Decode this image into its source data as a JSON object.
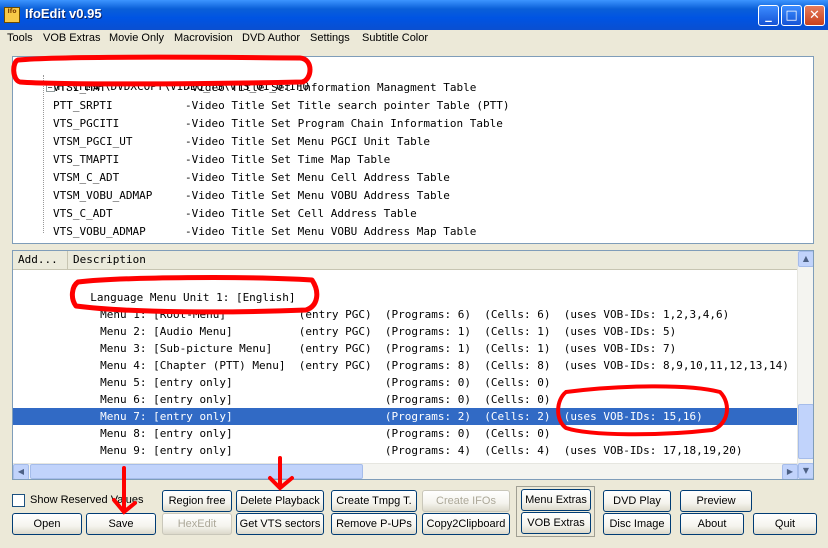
{
  "window": {
    "title": "IfoEdit v0.95",
    "icon_text": "Ifo",
    "controls": {
      "minimize": "_",
      "maximize": "□",
      "close": "✕"
    }
  },
  "menu": [
    "Tools",
    "VOB Extras",
    "Movie Only",
    "Macrovision",
    "DVD Author",
    "Settings",
    "Subtitle Color"
  ],
  "tree": {
    "root": "H:\\TEMP\\DVDXCOPY\\VIDEO_TS\\VTS_01_0.IFO",
    "expander": "−",
    "items": [
      {
        "name": "VTSI_MAT",
        "desc": "-Video Title Set Information Managment Table"
      },
      {
        "name": "PTT_SRPTI",
        "desc": "-Video Title Set Title search pointer Table (PTT)"
      },
      {
        "name": "VTS_PGCITI",
        "desc": "-Video Title Set Program Chain Information Table"
      },
      {
        "name": "VTSM_PGCI_UT",
        "desc": "-Video Title Set Menu PGCI Unit Table"
      },
      {
        "name": "VTS_TMAPTI",
        "desc": "-Video Title Set Time Map Table"
      },
      {
        "name": "VTSM_C_ADT",
        "desc": "-Video Title Set Menu Cell Address Table"
      },
      {
        "name": "VTSM_VOBU_ADMAP",
        "desc": "-Video Title Set Menu VOBU Address Table"
      },
      {
        "name": "VTS_C_ADT",
        "desc": "-Video Title Set Cell Address Table"
      },
      {
        "name": "VTS_VOBU_ADMAP",
        "desc": "-Video Title Set Menu VOBU Address Map Table"
      }
    ]
  },
  "list": {
    "columns": [
      "Add...",
      "Description"
    ],
    "rows": [
      {
        "text": "",
        "selected": false
      },
      {
        "text": "  Language Menu Unit 1: [English]",
        "selected": false
      },
      {
        "text": "     Menu 1: [Root-Menu]           (entry PGC)  (Programs: 6)  (Cells: 6)  (uses VOB-IDs: 1,2,3,4,6)",
        "selected": false
      },
      {
        "text": "     Menu 2: [Audio Menu]          (entry PGC)  (Programs: 1)  (Cells: 1)  (uses VOB-IDs: 5)",
        "selected": false
      },
      {
        "text": "     Menu 3: [Sub-picture Menu]    (entry PGC)  (Programs: 1)  (Cells: 1)  (uses VOB-IDs: 7)",
        "selected": false
      },
      {
        "text": "     Menu 4: [Chapter (PTT) Menu]  (entry PGC)  (Programs: 8)  (Cells: 8)  (uses VOB-IDs: 8,9,10,11,12,13,14)",
        "selected": false
      },
      {
        "text": "     Menu 5: [entry only]                       (Programs: 0)  (Cells: 0)",
        "selected": false
      },
      {
        "text": "     Menu 6: [entry only]                       (Programs: 0)  (Cells: 0)",
        "selected": false
      },
      {
        "text": "     Menu 7: [entry only]                       (Programs: 2)  (Cells: 2)  (uses VOB-IDs: 15,16)",
        "selected": true
      },
      {
        "text": "     Menu 8: [entry only]                       (Programs: 0)  (Cells: 0)",
        "selected": false
      },
      {
        "text": "     Menu 9: [entry only]                       (Programs: 4)  (Cells: 4)  (uses VOB-IDs: 17,18,19,20)",
        "selected": false
      }
    ],
    "scroll_arrows": {
      "up": "▲",
      "down": "▼",
      "left": "◀",
      "right": "▶"
    }
  },
  "bottom": {
    "show_reserved_label": "Show Reserved Values",
    "show_reserved_checked": false,
    "buttons": {
      "open": "Open",
      "save": "Save",
      "region_free": "Region free",
      "hexedit": "HexEdit",
      "delete_playback": "Delete Playback",
      "get_vts_sectors": "Get VTS sectors",
      "create_tmpg": "Create Tmpg T.",
      "remove_pups": "Remove P-UPs",
      "create_ifos": "Create IFOs",
      "copy2clipboard": "Copy2Clipboard",
      "menu_extras": "Menu Extras",
      "vob_extras": "VOB Extras",
      "dvd_play": "DVD Play",
      "disc_image": "Disc Image",
      "preview": "Preview",
      "about": "About",
      "quit": "Quit"
    }
  },
  "colors": {
    "annotation": "#ff0000",
    "selection": "#316ac5",
    "titlebar": "#0054e3"
  }
}
